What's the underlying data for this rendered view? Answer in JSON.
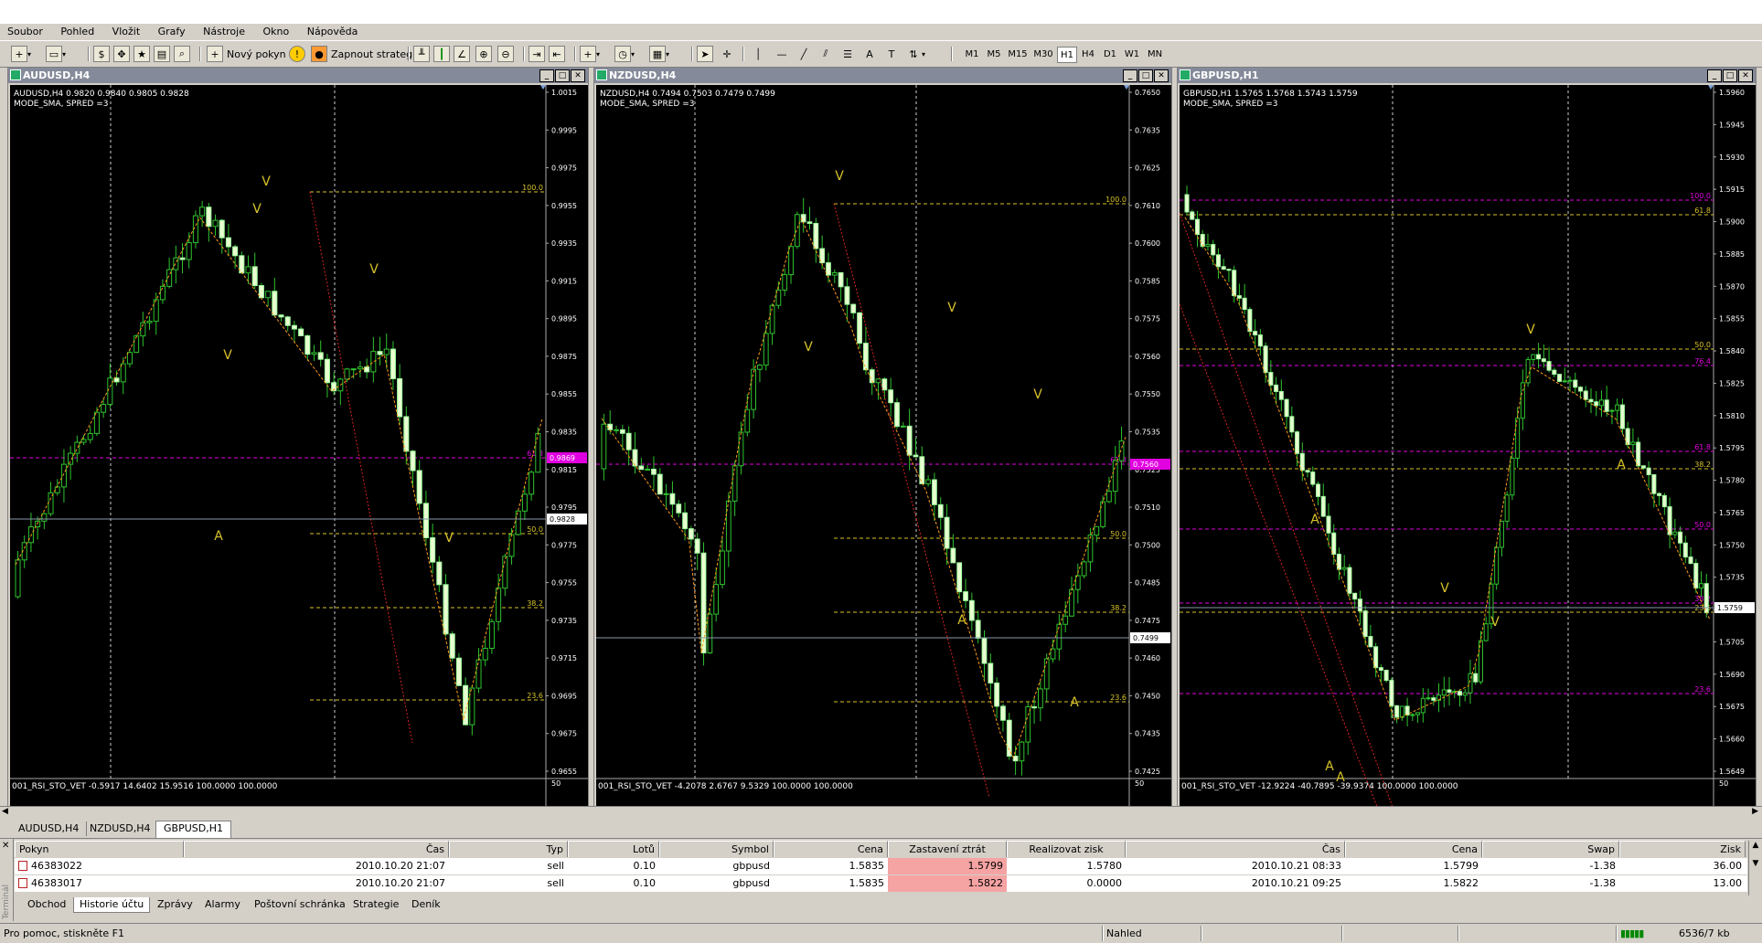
{
  "menu": [
    "Soubor",
    "Pohled",
    "Vložit",
    "Grafy",
    "Nástroje",
    "Okno",
    "Nápověda"
  ],
  "toolbar": {
    "new_order": "Nový pokyn",
    "start_strategy": "Zapnout strateg",
    "timeframes": [
      "M1",
      "M5",
      "M15",
      "M30",
      "H1",
      "H4",
      "D1",
      "W1",
      "MN"
    ],
    "active_timeframe": "H1"
  },
  "charts": [
    {
      "title": "AUDUSD,H4",
      "info1": "AUDUSD,H4  0.9820 0.9840 0.9805 0.9828",
      "info2": "MODE_SMA, SPRED =3",
      "indicator": "001_RSI_STO_VET -0.5917 14.6402 15.9516 100.0000 100.0000",
      "price_labels": [
        "1.0015",
        "0.9995",
        "0.9975",
        "0.9955",
        "0.9935",
        "0.9915",
        "0.9895",
        "0.9875",
        "0.9855",
        "0.9835",
        "0.9815",
        "0.9795",
        "0.9775",
        "0.9755",
        "0.9735",
        "0.9715",
        "0.9695",
        "0.9675",
        "0.9655"
      ],
      "current_price": "0.9828",
      "fib_price": "0.9869",
      "fib_labels": [
        "100.0",
        "61.8",
        "50.0",
        "38.2",
        "23.6",
        "0.0"
      ],
      "ind_level": "50",
      "markers": [
        "V",
        "V",
        "V",
        "V",
        "V",
        "A"
      ]
    },
    {
      "title": "NZDUSD,H4",
      "info1": "NZDUSD,H4  0.7494 0.7503 0.7479 0.7499",
      "info2": "MODE_SMA, SPRED =3",
      "indicator": "001_RSI_STO_VET -4.2078 2.6767 9.5329 100.0000 100.0000",
      "price_labels": [
        "0.7650",
        "0.7635",
        "0.7625",
        "0.7610",
        "0.7600",
        "0.7585",
        "0.7575",
        "0.7560",
        "0.7550",
        "0.7535",
        "0.7525",
        "0.7510",
        "0.7500",
        "0.7485",
        "0.7475",
        "0.7460",
        "0.7450",
        "0.7435",
        "0.7425"
      ],
      "current_price": "0.7499",
      "fib_price": "0.7560",
      "fib_labels": [
        "100.0",
        "61.8",
        "50.0",
        "38.2",
        "23.6",
        "0.0"
      ],
      "ind_level": "50",
      "markers": [
        "V",
        "V",
        "V",
        "V",
        "A",
        "A"
      ]
    },
    {
      "title": "GBPUSD,H1",
      "info1": "GBPUSD,H1  1.5765 1.5768 1.5743 1.5759",
      "info2": "MODE_SMA, SPRED =3",
      "indicator": "001_RSI_STO_VET -12.9224 -40.7895 -39.9374 100.0000 100.0000",
      "price_labels": [
        "1.5960",
        "1.5945",
        "1.5930",
        "1.5915",
        "1.5900",
        "1.5885",
        "1.5870",
        "1.5855",
        "1.5840",
        "1.5825",
        "1.5810",
        "1.5795",
        "1.5780",
        "1.5765",
        "1.5750",
        "1.5735",
        "1.5720",
        "1.5705",
        "1.5690",
        "1.5675",
        "1.5660",
        "1.5649"
      ],
      "current_price": "1.5759",
      "fib_labels_yellow": [
        "61.8",
        "50.0",
        "38.2",
        "23.6",
        "0.0"
      ],
      "fib_labels_magenta": [
        "100.0",
        "76.4",
        "61.8",
        "50.0",
        "38.2",
        "23.6"
      ],
      "ind_level": "50",
      "markers": [
        "V",
        "V",
        "V",
        "A",
        "A",
        "A",
        "A",
        "A"
      ]
    }
  ],
  "chart_tabs": [
    "AUDUSD,H4",
    "NZDUSD,H4",
    "GBPUSD,H1"
  ],
  "active_chart_tab": "GBPUSD,H1",
  "terminal": {
    "columns": [
      "Pokyn",
      "Čas",
      "Typ",
      "Lotů",
      "Symbol",
      "Cena",
      "Zastavení ztrát",
      "Realizovat zisk",
      "Čas",
      "Cena",
      "Swap",
      "Zisk"
    ],
    "rows": [
      [
        "46383022",
        "2010.10.20 21:07",
        "sell",
        "0.10",
        "gbpusd",
        "1.5835",
        "1.5799",
        "1.5780",
        "2010.10.21 08:33",
        "1.5799",
        "-1.38",
        "36.00"
      ],
      [
        "46383017",
        "2010.10.20 21:07",
        "sell",
        "0.10",
        "gbpusd",
        "1.5835",
        "1.5822",
        "0.0000",
        "2010.10.21 09:25",
        "1.5822",
        "-1.38",
        "13.00"
      ]
    ],
    "tabs": [
      "Obchod",
      "Historie účtu",
      "Zprávy",
      "Alarmy",
      "Poštovní schránka",
      "Strategie",
      "Deník"
    ],
    "active_tab": "Historie účtu",
    "side_label": "Terminál"
  },
  "status": {
    "help": "Pro pomoc, stiskněte F1",
    "profile": "Nahled",
    "traffic": "6536/7 kb"
  }
}
